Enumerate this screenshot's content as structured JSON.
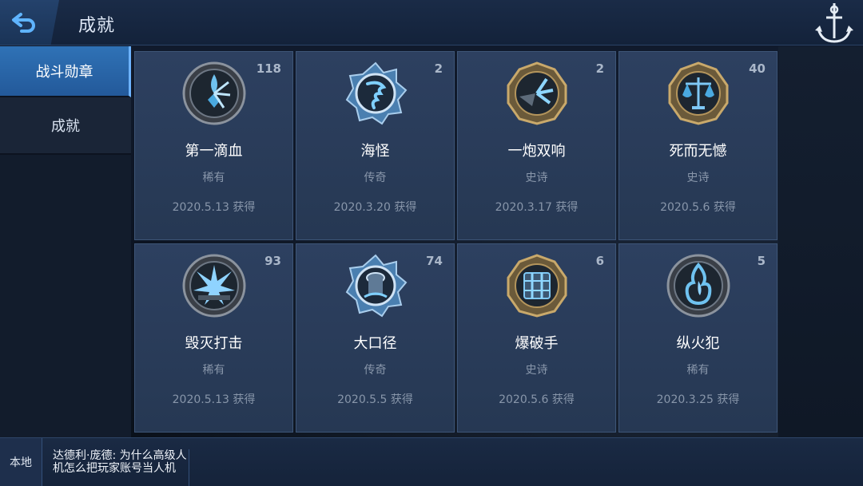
{
  "header": {
    "title": "成就"
  },
  "sidebar": {
    "items": [
      {
        "label": "战斗勋章"
      },
      {
        "label": "成就"
      }
    ]
  },
  "cards": [
    {
      "name": "第一滴血",
      "rarity": "稀有",
      "date": "2020.5.13  获得",
      "count": "118",
      "medal": "first-blood-medal-icon",
      "frame": "silver"
    },
    {
      "name": "海怪",
      "rarity": "传奇",
      "date": "2020.3.20  获得",
      "count": "2",
      "medal": "sea-monster-medal-icon",
      "frame": "legend"
    },
    {
      "name": "一炮双响",
      "rarity": "史诗",
      "date": "2020.3.17  获得",
      "count": "2",
      "medal": "double-shot-medal-icon",
      "frame": "gold"
    },
    {
      "name": "死而无憾",
      "rarity": "史诗",
      "date": "2020.5.6   获得",
      "count": "40",
      "medal": "scales-medal-icon",
      "frame": "gold"
    },
    {
      "name": "毁灭打击",
      "rarity": "稀有",
      "date": "2020.5.13  获得",
      "count": "93",
      "medal": "devastating-strike-medal-icon",
      "frame": "silver"
    },
    {
      "name": "大口径",
      "rarity": "传奇",
      "date": "2020.5.5   获得",
      "count": "74",
      "medal": "big-caliber-medal-icon",
      "frame": "legend"
    },
    {
      "name": "爆破手",
      "rarity": "史诗",
      "date": "2020.5.6   获得",
      "count": "6",
      "medal": "demolition-medal-icon",
      "frame": "gold"
    },
    {
      "name": "纵火犯",
      "rarity": "稀有",
      "date": "2020.3.25  获得",
      "count": "5",
      "medal": "arsonist-medal-icon",
      "frame": "silver"
    }
  ],
  "chat": {
    "channel": "本地",
    "message": "达德利·庞德: 为什么高级人机怎么把玩家账号当人机"
  },
  "colors": {
    "accent": "#2f72b6",
    "card_bg": "#2d4060",
    "rarity_text": "#8896aa",
    "medal_blue": "#6fc2f0"
  }
}
